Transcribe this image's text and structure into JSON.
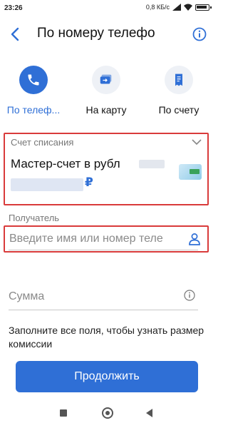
{
  "status": {
    "time": "23:26",
    "network_speed": "0,8 КБ/с"
  },
  "header": {
    "title": "По номеру телефо",
    "back_icon": "back-arrow-icon",
    "info_icon": "info-icon"
  },
  "tabs": [
    {
      "label": "По телеф...",
      "icon": "phone-icon",
      "active": true
    },
    {
      "label": "На карту",
      "icon": "card-transfer-icon",
      "active": false
    },
    {
      "label": "По счету",
      "icon": "receipt-icon",
      "active": false
    }
  ],
  "account": {
    "caption": "Счет списания",
    "name": "Мастер-счет в рубл",
    "currency_symbol": "₽"
  },
  "recipient": {
    "caption": "Получатель",
    "placeholder": "Введите имя или номер теле"
  },
  "amount": {
    "placeholder": "Сумма"
  },
  "hint": "Заполните все поля, чтобы узнать размер комиссии",
  "continue_label": "Продолжить",
  "colors": {
    "accent": "#2f6fd6",
    "highlight": "#d93b3b"
  }
}
